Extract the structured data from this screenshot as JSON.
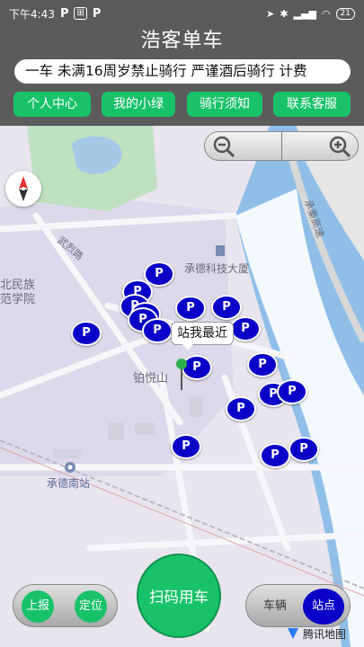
{
  "status_bar": {
    "time": "下午4:43",
    "battery": "21",
    "left_icons": [
      "P",
      "P"
    ],
    "right_icons": [
      "location-icon",
      "bluetooth-icon",
      "signal-icon",
      "wifi-icon",
      "battery-icon"
    ]
  },
  "app_title": "浩客单车",
  "notice_text": "一车 未满16周岁禁止骑行 严谨酒后骑行 计费",
  "nav": [
    "个人中心",
    "我的小绿",
    "骑行须知",
    "联系客服"
  ],
  "map": {
    "nearest_label": "站我最近",
    "pin_label": "P",
    "place_labels": [
      "承德科技大厦",
      "铂悦山",
      "承德南站",
      "承秦高速",
      "北民族",
      "范学院",
      "武烈路"
    ],
    "provider": "腾讯地图"
  },
  "bottom": {
    "report_label": "上报",
    "locate_label": "定位",
    "scan_label": "扫码用车",
    "vehicle_label": "车辆",
    "station_label": "站点"
  },
  "colors": {
    "accent_green": "#18c269",
    "pin_blue": "#0a00c8",
    "header_gray": "#5a5a5a"
  }
}
